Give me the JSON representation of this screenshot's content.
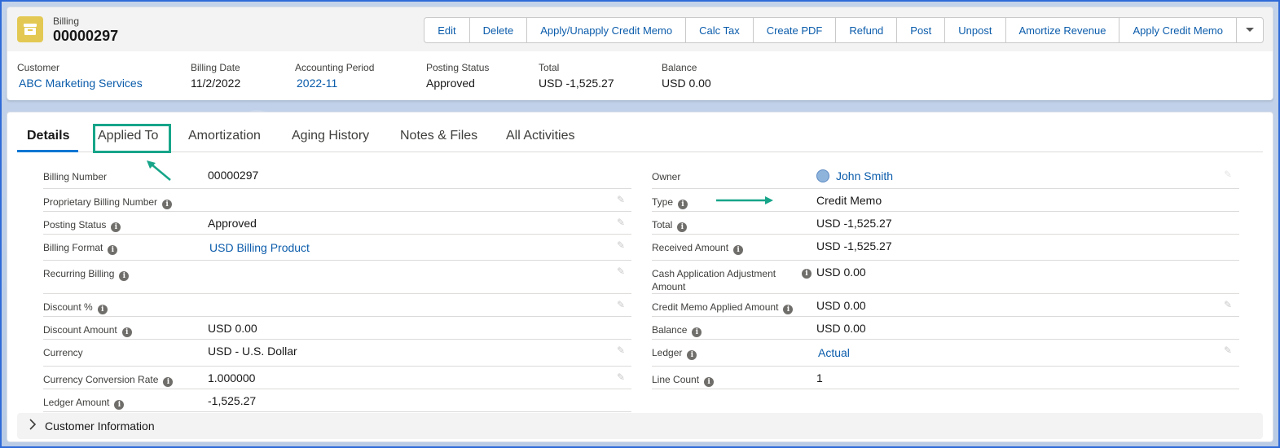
{
  "header": {
    "object_label": "Billing",
    "record_name": "00000297",
    "icon": "billing-icon",
    "icon_color": "#e3c954",
    "actions": [
      "Edit",
      "Delete",
      "Apply/Unapply Credit Memo",
      "Calc Tax",
      "Create PDF",
      "Refund",
      "Post",
      "Unpost",
      "Amortize Revenue",
      "Apply Credit Memo"
    ],
    "more_icon": "chevron-down-icon"
  },
  "highlights": {
    "customer_label": "Customer",
    "customer_value": "ABC Marketing Services",
    "billing_date_label": "Billing Date",
    "billing_date_value": "11/2/2022",
    "accounting_period_label": "Accounting Period",
    "accounting_period_value": "2022-11",
    "posting_status_label": "Posting Status",
    "posting_status_value": "Approved",
    "total_label": "Total",
    "total_value": "USD -1,525.27",
    "balance_label": "Balance",
    "balance_value": "USD 0.00"
  },
  "tabs": [
    "Details",
    "Applied To",
    "Amortization",
    "Aging History",
    "Notes & Files",
    "All Activities"
  ],
  "left_fields": [
    {
      "label": "Billing Number",
      "value": "00000297"
    },
    {
      "label": "Proprietary Billing Number",
      "value": ""
    },
    {
      "label": "Posting Status",
      "value": "Approved"
    },
    {
      "label": "Billing Format",
      "value": "USD Billing Product"
    },
    {
      "label": "Recurring Billing",
      "value": ""
    },
    {
      "label": "Discount %",
      "value": ""
    },
    {
      "label": "Discount Amount",
      "value": "USD 0.00"
    },
    {
      "label": "Currency",
      "value": "USD - U.S. Dollar"
    },
    {
      "label": "Currency Conversion Rate",
      "value": "1.000000"
    },
    {
      "label": "Ledger Amount",
      "value": "-1,525.27"
    }
  ],
  "right_fields": [
    {
      "label": "Owner",
      "value": "John Smith"
    },
    {
      "label": "Type",
      "value": "Credit Memo"
    },
    {
      "label": "Total",
      "value": "USD -1,525.27"
    },
    {
      "label": "Received Amount",
      "value": "USD -1,525.27"
    },
    {
      "label": "Cash Application Adjustment",
      "label2": "Amount",
      "value": "USD 0.00"
    },
    {
      "label": "Credit Memo Applied Amount",
      "value": "USD 0.00"
    },
    {
      "label": "Balance",
      "value": "USD 0.00"
    },
    {
      "label": "Ledger",
      "value": "Actual"
    },
    {
      "label": "Line Count",
      "value": "1"
    }
  ],
  "section": {
    "title": "Customer Information"
  },
  "colors": {
    "link": "#0b5cab",
    "annotation": "#17a589",
    "active_tab": "#0176d3"
  }
}
